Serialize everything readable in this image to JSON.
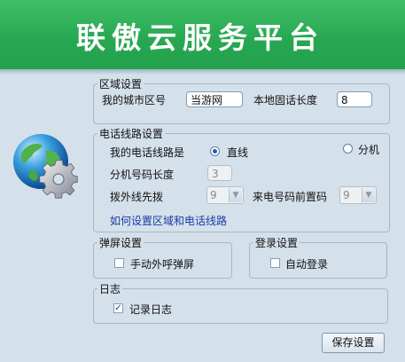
{
  "banner": {
    "title": "联傲云服务平台"
  },
  "area": {
    "legend": "区域设置",
    "city_code_label": "我的城市区号",
    "city_code_value": "当游网",
    "local_len_label": "本地固话长度",
    "local_len_value": "8"
  },
  "line": {
    "legend": "电话线路设置",
    "my_line_label": "我的电话线路是",
    "direct_label": "直线",
    "extension_label": "分机",
    "selected": "直线",
    "ext_len_label": "分机号码长度",
    "ext_len_value": "3",
    "outside_label": "拨外线先拨",
    "outside_value": "9",
    "prefix_label": "来电号码前置码",
    "prefix_value": "9",
    "help_link": "如何设置区域和电话线路"
  },
  "popup": {
    "legend": "弹屏设置",
    "manual_label": "手动外呼弹屏",
    "manual_checked": false
  },
  "login": {
    "legend": "登录设置",
    "auto_label": "自动登录",
    "auto_checked": false
  },
  "log": {
    "legend": "日志",
    "record_label": "记录日志",
    "record_checked": true
  },
  "actions": {
    "save_label": "保存设置"
  },
  "icons": [
    "globe-gear-icon",
    "chevron-down-icon"
  ]
}
